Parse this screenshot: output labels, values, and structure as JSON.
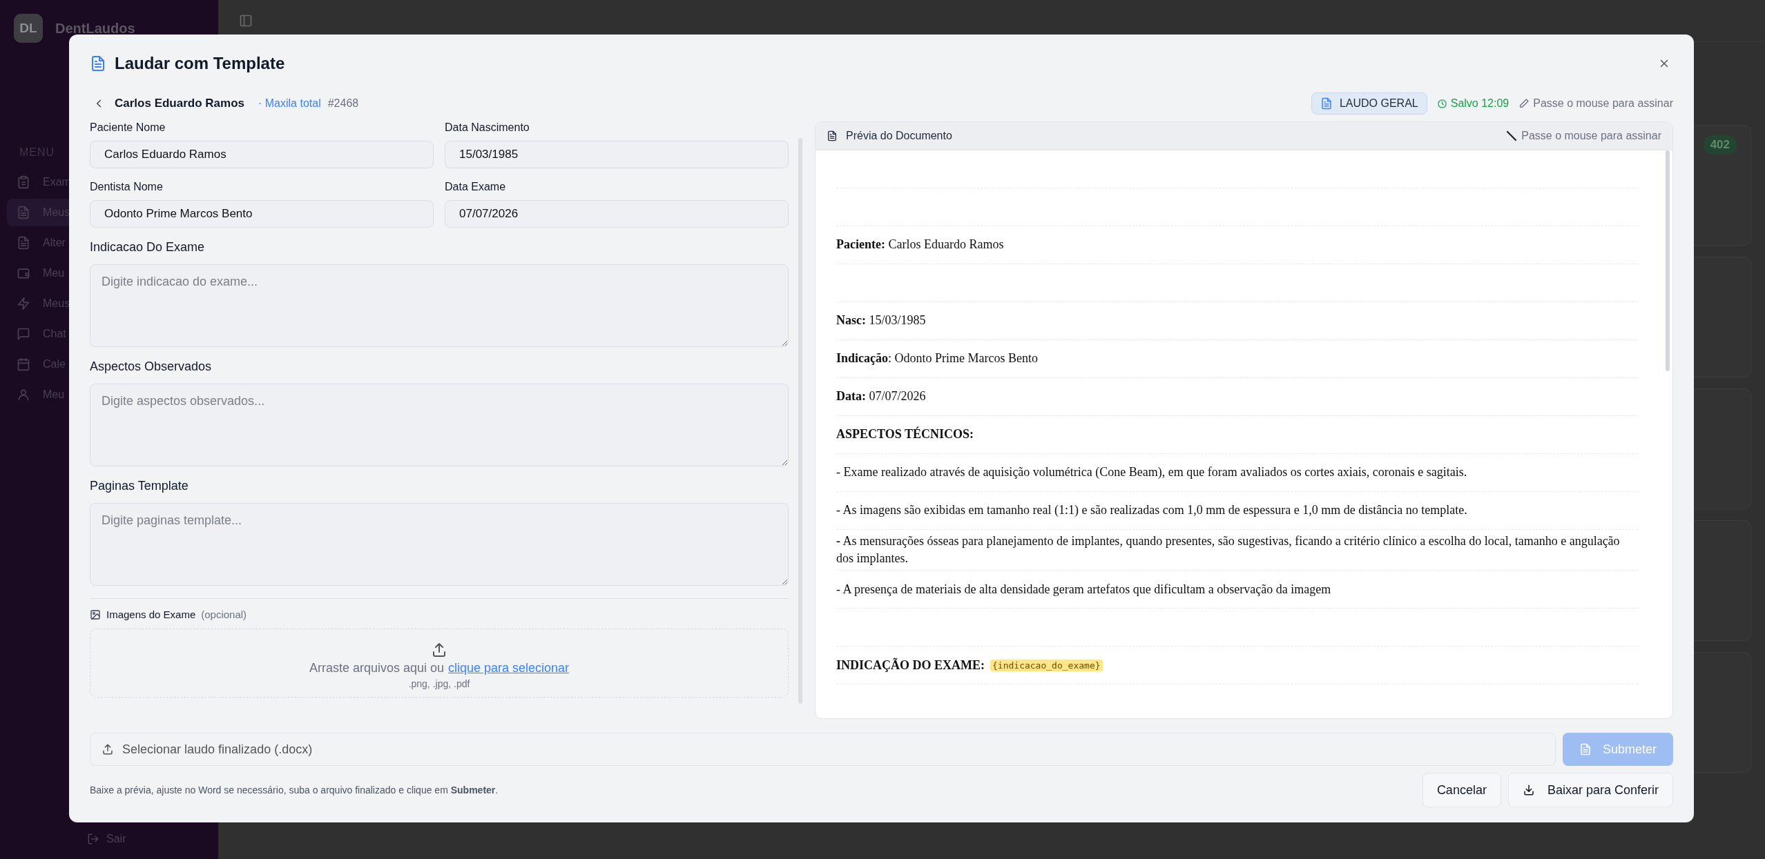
{
  "sidebar": {
    "logo": "DL",
    "app_name": "DentLaudos",
    "section": "MENU",
    "items": [
      {
        "label": "Exam",
        "selected": false
      },
      {
        "label": "Meus",
        "selected": true
      },
      {
        "label": "Alter",
        "selected": false
      },
      {
        "label": "Meu",
        "selected": false
      },
      {
        "label": "Meus",
        "selected": false
      },
      {
        "label": "Chat",
        "selected": false
      },
      {
        "label": "Cale",
        "selected": false
      },
      {
        "label": "Meu",
        "selected": false
      }
    ],
    "logout": "Sair"
  },
  "background": {
    "count_badge": "402"
  },
  "modal": {
    "title": "Laudar com Template"
  },
  "patient": {
    "name": "Carlos Eduardo Ramos",
    "exam": "· Maxila total",
    "id": "#2468"
  },
  "status": {
    "template_badge": "LAUDO GERAL",
    "saved": "Salvo 12:09",
    "sign_hint": "Passe o mouse para assinar"
  },
  "form": {
    "fields": [
      {
        "kind": "input",
        "label": "Paciente Nome",
        "value": "Carlos Eduardo Ramos"
      },
      {
        "kind": "input",
        "label": "Data Nascimento",
        "value": "15/03/1985"
      },
      {
        "kind": "input",
        "label": "Dentista Nome",
        "value": "Odonto Prime Marcos Bento"
      },
      {
        "kind": "input",
        "label": "Data Exame",
        "value": "07/07/2026"
      },
      {
        "kind": "textarea",
        "label": "Indicacao Do Exame",
        "placeholder": "Digite indicacao do exame..."
      },
      {
        "kind": "textarea",
        "label": "Aspectos Observados",
        "placeholder": "Digite aspectos observados..."
      },
      {
        "kind": "textarea",
        "label": "Paginas Template",
        "placeholder": "Digite paginas template..."
      }
    ],
    "images": {
      "label": "Imagens do Exame",
      "optional": "(opcional)",
      "drop_text": "Arraste arquivos aqui ou",
      "drop_link": "clique para selecionar",
      "formats": ".png, .jpg, .pdf"
    }
  },
  "preview": {
    "title": "Prévia do Documento",
    "sign_hint": "Passe o mouse para assinar",
    "rows": [
      {
        "kind": "blank"
      },
      {
        "kind": "blank"
      },
      {
        "kind": "text",
        "text": "**Paciente:** Carlos Eduardo Ramos"
      },
      {
        "kind": "blank"
      },
      {
        "kind": "text",
        "text": "**Nasc:** 15/03/1985"
      },
      {
        "kind": "text",
        "text": "**Indicação**: Odonto Prime Marcos Bento"
      },
      {
        "kind": "text",
        "text": "**Data:** 07/07/2026"
      },
      {
        "kind": "heading",
        "text": "ASPECTOS TÉCNICOS:"
      },
      {
        "kind": "text",
        "text": "- Exame realizado através de aquisição volumétrica (Cone Beam), em que foram avaliados os cortes axiais, coronais e sagitais."
      },
      {
        "kind": "text",
        "text": "- As imagens são exibidas em tamanho real (1:1) e são realizadas com 1,0 mm de espessura e 1,0 mm de distância no template."
      },
      {
        "kind": "text",
        "text": "**-** As mensurações ósseas para planejamento de implantes, quando presentes, são sugestivas, ficando a critério clínico a escolha do local, tamanho e angulação dos implantes."
      },
      {
        "kind": "text",
        "text": "- A presença de materiais de alta densidade geram artefatos que dificultam a observação da imagem"
      },
      {
        "kind": "blank"
      },
      {
        "kind": "heading",
        "text": "INDICAÇÃO DO EXAME:",
        "token": "{indicacao_do_exame}"
      }
    ]
  },
  "upload": {
    "label": "Selecionar laudo finalizado (.docx)"
  },
  "submit": {
    "label": "Submeter",
    "disabled": true
  },
  "footer": {
    "hint": "Baixe a prévia, ajuste no Word se necessário, suba o arquivo finalizado e clique em **Submeter**.",
    "buttons": [
      {
        "kind": "secondary",
        "label": "Cancelar"
      },
      {
        "kind": "download",
        "label": "Baixar para Conferir"
      }
    ]
  }
}
